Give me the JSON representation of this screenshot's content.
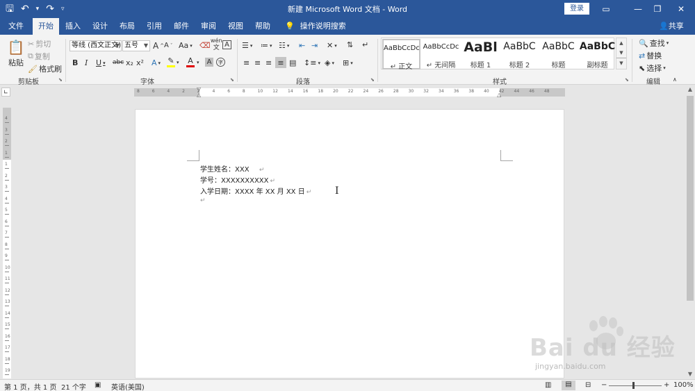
{
  "titlebar": {
    "title": "新建 Microsoft Word 文档 - Word",
    "login": "登录",
    "quick_access": [
      {
        "icon": "save-icon",
        "glyph": "🖫"
      },
      {
        "icon": "undo-icon",
        "glyph": "↶"
      },
      {
        "icon": "undo-dropdown-icon",
        "glyph": "▾"
      },
      {
        "icon": "redo-icon",
        "glyph": "↷"
      },
      {
        "icon": "customize-qat-icon",
        "glyph": "▿"
      }
    ],
    "window_controls": {
      "ribbon_display": "▭",
      "minimize": "—",
      "restore": "❐",
      "close": "✕"
    }
  },
  "tabs": {
    "file": "文件",
    "home": "开始",
    "insert": "插入",
    "design": "设计",
    "layout": "布局",
    "references": "引用",
    "mailings": "邮件",
    "review": "审阅",
    "view": "视图",
    "help": "帮助",
    "tell_me": "操作说明搜索",
    "share": "共享"
  },
  "ribbon": {
    "clipboard": {
      "label": "剪贴板",
      "paste": "粘贴",
      "cut": "剪切",
      "copy": "复制",
      "format_painter": "格式刷"
    },
    "font": {
      "label": "字体",
      "font_name": "等线 (西文正文)",
      "font_size": "五号",
      "grow": "A",
      "shrink": "A",
      "change_case": "Aa",
      "wen": "wén",
      "char_border": "A",
      "bold": "B",
      "italic": "I",
      "underline": "U",
      "strikethrough": "abc",
      "subscript": "x₂",
      "superscript": "x²",
      "text_effects": "A",
      "font_color": "A",
      "char_shading": "A",
      "enclose": "字"
    },
    "paragraph": {
      "label": "段落"
    },
    "styles": {
      "label": "样式",
      "items": [
        {
          "preview": "AaBbCcDc",
          "name": "↵ 正文"
        },
        {
          "preview": "AaBbCcDc",
          "name": "↵ 无间隔"
        },
        {
          "preview": "AaBl",
          "name": "标题 1"
        },
        {
          "preview": "AaBbC",
          "name": "标题 2"
        },
        {
          "preview": "AaBbC",
          "name": "标题"
        },
        {
          "preview": "AaBbC",
          "name": "副标题"
        }
      ]
    },
    "editing": {
      "label": "编辑",
      "find": "查找",
      "replace": "替换",
      "select": "选择"
    }
  },
  "document": {
    "lines": [
      "学生姓名：XXX  ",
      "学号：XXXXXXXXXX",
      "入学日期：XXXX 年 XX 月 XX 日",
      ""
    ],
    "para_mark": "↵"
  },
  "statusbar": {
    "page": "第 1 页，共 1 页",
    "words": "21 个字",
    "language": "英语(美国)",
    "zoom": "100%",
    "zoom_minus": "−",
    "zoom_plus": "+"
  },
  "ruler": {
    "h_numbers": [
      "8",
      "6",
      "4",
      "2",
      "2",
      "4",
      "6",
      "8",
      "10",
      "12",
      "14",
      "16",
      "18",
      "20",
      "22",
      "24",
      "26",
      "28",
      "30",
      "32",
      "34",
      "36",
      "38",
      "40",
      "42",
      "44",
      "46",
      "48"
    ],
    "v_numbers": [
      "4",
      "3",
      "2",
      "1",
      "1",
      "2",
      "3",
      "4",
      "5",
      "6",
      "7",
      "8",
      "9",
      "10",
      "11",
      "12",
      "13",
      "14",
      "15",
      "16",
      "17",
      "18",
      "19"
    ]
  },
  "watermark": {
    "main": "Bai du 经验",
    "sub": "jingyan.baidu.com"
  },
  "colors": {
    "accent": "#2b579a",
    "ribbon_bg": "#f3f3f3",
    "workspace_bg": "#e6e6e6",
    "font_color_bar": "#e00000",
    "highlight_bar": "#ffff00"
  }
}
